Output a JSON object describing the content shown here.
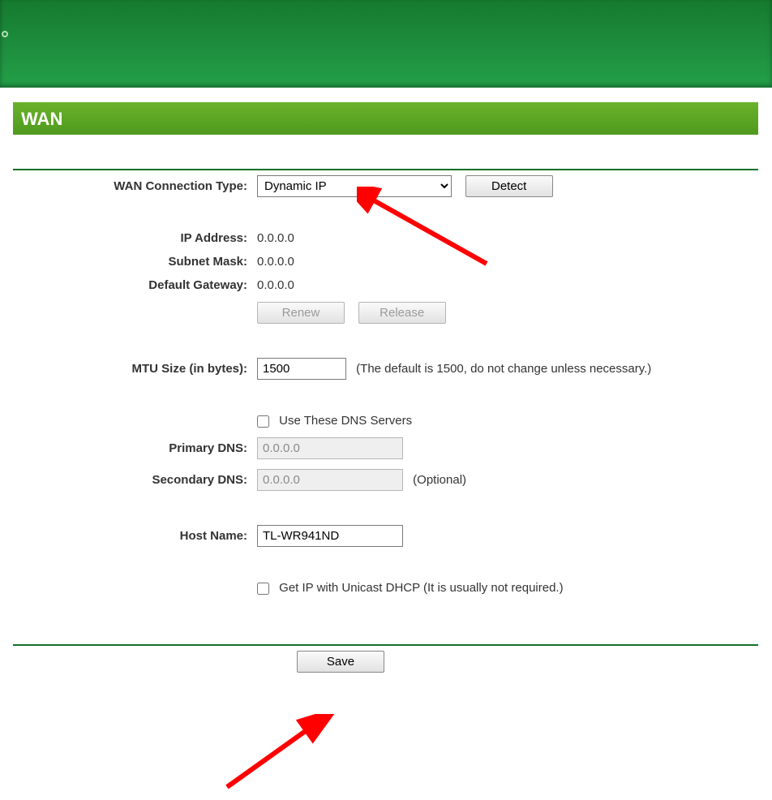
{
  "section_title": "WAN",
  "labels": {
    "connection_type": "WAN Connection Type:",
    "ip_address": "IP Address:",
    "subnet_mask": "Subnet Mask:",
    "default_gateway": "Default Gateway:",
    "mtu": "MTU Size (in bytes):",
    "primary_dns": "Primary DNS:",
    "secondary_dns": "Secondary DNS:",
    "host_name": "Host Name:"
  },
  "values": {
    "connection_type": "Dynamic IP",
    "ip_address": "0.0.0.0",
    "subnet_mask": "0.0.0.0",
    "default_gateway": "0.0.0.0",
    "mtu": "1500",
    "primary_dns": "0.0.0.0",
    "secondary_dns": "0.0.0.0",
    "host_name": "TL-WR941ND"
  },
  "buttons": {
    "detect": "Detect",
    "renew": "Renew",
    "release": "Release",
    "save": "Save"
  },
  "texts": {
    "mtu_hint": "(The default is 1500, do not change unless necessary.)",
    "use_dns": "Use These DNS Servers",
    "optional": "(Optional)",
    "unicast": "Get IP with Unicast DHCP (It is usually not required.)"
  }
}
